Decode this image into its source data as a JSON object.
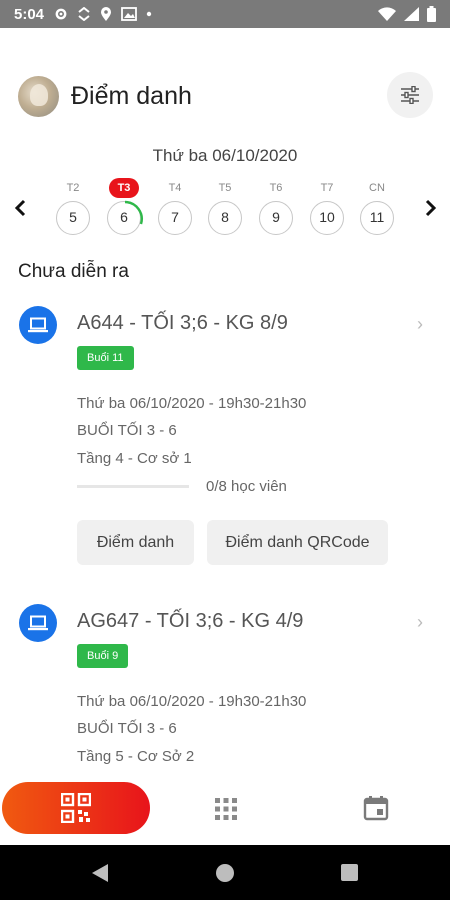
{
  "status_bar": {
    "time": "5:04"
  },
  "header": {
    "title": "Điểm danh"
  },
  "date": {
    "title": "Thứ ba 06/10/2020",
    "days": [
      {
        "name": "T2",
        "num": "5"
      },
      {
        "name": "T3",
        "num": "6"
      },
      {
        "name": "T4",
        "num": "7"
      },
      {
        "name": "T5",
        "num": "8"
      },
      {
        "name": "T6",
        "num": "9"
      },
      {
        "name": "T7",
        "num": "10"
      },
      {
        "name": "CN",
        "num": "11"
      }
    ],
    "selected_index": 1
  },
  "section": {
    "title": "Chưa diễn ra"
  },
  "classes": [
    {
      "name": "A644 - TỐI 3;6 - KG 8/9",
      "badge": "Buổi 11",
      "schedule": "Thứ ba 06/10/2020 - 19h30-21h30",
      "shift": "BUỔI TỐI 3 - 6",
      "location": "Tầng 4 - Cơ sở 1",
      "progress": 0,
      "attendance": "0/8 học viên",
      "button_attendance": "Điểm danh",
      "button_qr": "Điểm danh QRCode"
    },
    {
      "name": "AG647 - TỐI 3;6 - KG 4/9",
      "badge": "Buổi 9",
      "schedule": "Thứ ba 06/10/2020 - 19h30-21h30",
      "shift": "BUỔI TỐI 3 - 6",
      "location": "Tầng 5 - Cơ Sở 2"
    }
  ],
  "colors": {
    "accent_red": "#e8141b",
    "badge_green": "#2fb84a",
    "class_icon_blue": "#1a73e8"
  },
  "icons": {
    "status": [
      "settings-icon",
      "sync-icon",
      "location-icon",
      "image-icon",
      "dot-icon",
      "wifi-icon",
      "signal-icon",
      "battery-icon"
    ],
    "header_action": "filter-sliders-icon",
    "class": "laptop-icon",
    "bottom_nav": [
      "qr-code-icon",
      "grid-icon",
      "calendar-icon"
    ]
  }
}
